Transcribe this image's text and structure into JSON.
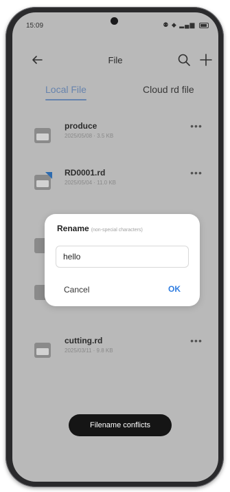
{
  "status_bar": {
    "time": "15:09",
    "icons": "⚉ ◆ ▂▄▆"
  },
  "topbar": {
    "title": "File"
  },
  "tabs": [
    {
      "label": "Local File"
    },
    {
      "label": "Cloud rd file"
    }
  ],
  "files": [
    {
      "name": "produce",
      "meta": "2025/05/08 · 3.5 KB"
    },
    {
      "name": "RD0001.rd",
      "meta": "2025/05/04 · 11.0 KB"
    },
    {
      "name": "cutting.rd",
      "meta": "2025/03/11 · 9.8 KB"
    }
  ],
  "dialog": {
    "title": "Rename",
    "hint": "(non-special characters)",
    "input_value": "hello",
    "cancel_label": "Cancel",
    "ok_label": "OK"
  },
  "toast": {
    "text": "Filename conflicts"
  },
  "colors": {
    "accent": "#2f7de1",
    "tab_active": "#6a88b3",
    "dim_bg": "#bfbfbf",
    "toast_bg": "#151515"
  }
}
